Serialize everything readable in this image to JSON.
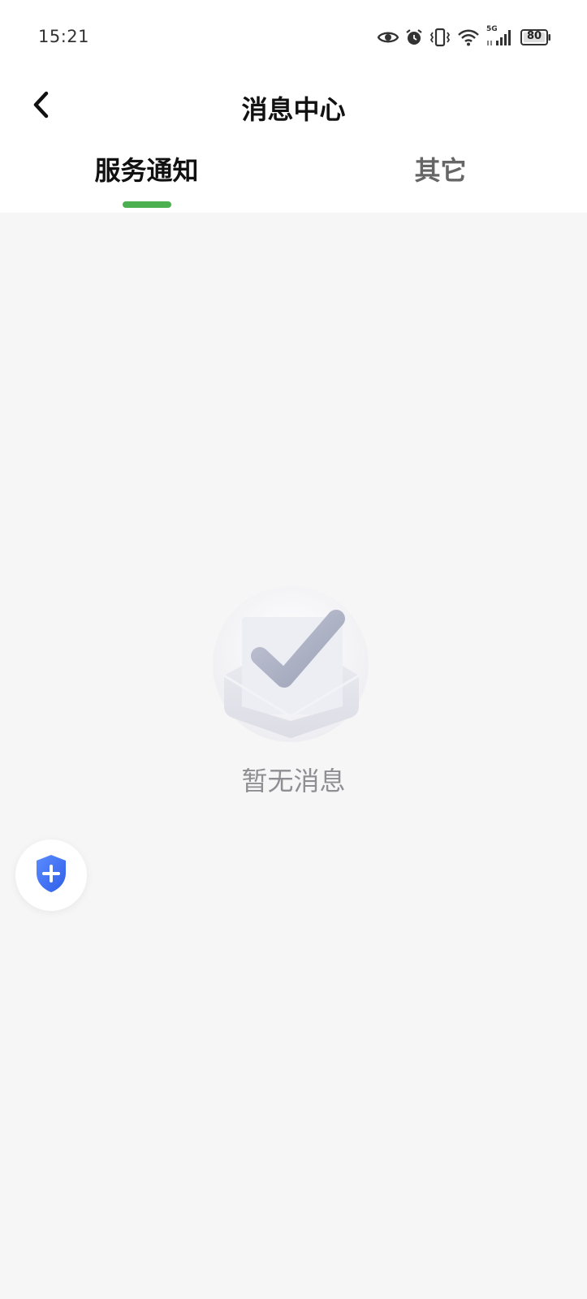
{
  "status_bar": {
    "time": "15:21",
    "network": "5G",
    "battery": "80",
    "icons": [
      "eye-icon",
      "alarm-icon",
      "vibrate-icon",
      "wifi-icon",
      "signal-icon",
      "battery-icon"
    ]
  },
  "header": {
    "title": "消息中心",
    "back_icon": "chevron-left-icon"
  },
  "tabs": [
    {
      "label": "服务通知",
      "active": true
    },
    {
      "label": "其它",
      "active": false
    }
  ],
  "empty_state": {
    "icon": "inbox-check-icon",
    "message": "暂无消息"
  },
  "float_button": {
    "icon": "shield-plus-icon"
  },
  "colors": {
    "accent": "#4caf50",
    "background": "#f6f6f7",
    "shield_blue": "#3d6ef5"
  }
}
